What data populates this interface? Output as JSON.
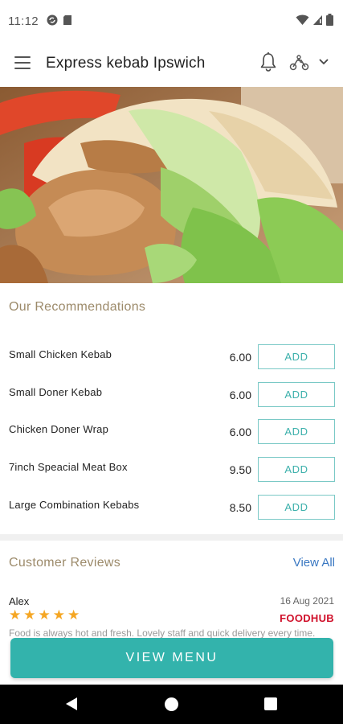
{
  "status_bar": {
    "time": "11:12",
    "left_icons": [
      "sync-icon",
      "sd-card-icon"
    ],
    "right_icons": [
      "wifi-icon",
      "signal-icon",
      "battery-icon"
    ]
  },
  "header": {
    "title": "Express kebab Ipswich",
    "icons": [
      "menu-icon",
      "bell-icon",
      "delivery-icon",
      "chevron-down-icon"
    ]
  },
  "recommendations": {
    "title": "Our Recommendations",
    "items": [
      {
        "name": "Small Chicken Kebab",
        "price": "6.00",
        "button": "ADD"
      },
      {
        "name": "Small Doner Kebab",
        "price": "6.00",
        "button": "ADD"
      },
      {
        "name": "Chicken Doner Wrap",
        "price": "6.00",
        "button": "ADD"
      },
      {
        "name": "7inch Speacial Meat Box",
        "price": "9.50",
        "button": "ADD"
      },
      {
        "name": "Large Combination Kebabs",
        "price": "8.50",
        "button": "ADD"
      }
    ]
  },
  "reviews": {
    "title": "Customer Reviews",
    "view_all": "View All",
    "items": [
      {
        "author": "Alex",
        "date": "16 Aug 2021",
        "rating": 5,
        "source": "FOODHUB",
        "text": "Food is always hot and fresh. Lovely staff and quick delivery every time."
      }
    ]
  },
  "cta": {
    "label": "VIEW MENU"
  },
  "colors": {
    "accent": "#33b3ac",
    "section_title": "#9c8a6a",
    "link": "#3a78c2",
    "star": "#f5a623",
    "foodhub": "#d0112b"
  }
}
